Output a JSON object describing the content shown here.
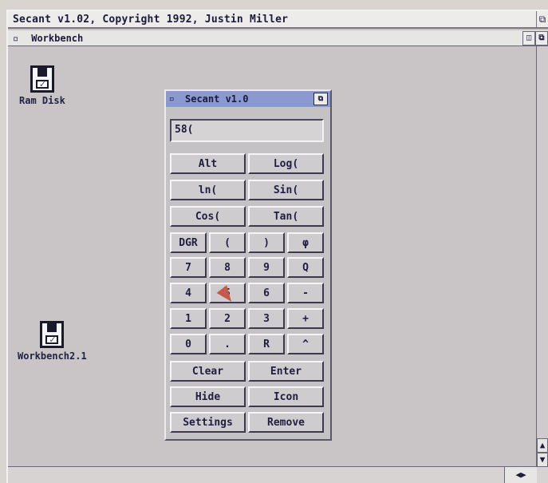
{
  "screen": {
    "title": "Secant v1.02, Copyright 1992, Justin Miller"
  },
  "workbench": {
    "title": "Workbench"
  },
  "desktop_icons": [
    {
      "label": "Ram Disk",
      "icon": "floppy-disk-icon"
    },
    {
      "label": "Workbench2.1",
      "icon": "floppy-disk-icon"
    }
  ],
  "calculator": {
    "title": "Secant v1.0",
    "display": "58(",
    "buttons": {
      "alt": "Alt",
      "log": "Log(",
      "ln": "ln(",
      "sin": "Sin(",
      "cos": "Cos(",
      "tan": "Tan(",
      "dgr": "DGR",
      "lparen": "(",
      "rparen": ")",
      "power": "φ",
      "7": "7",
      "8": "8",
      "9": "9",
      "div": "Q",
      "4": "4",
      "5": "5",
      "6": "6",
      "minus": "-",
      "1": "1",
      "2": "2",
      "3": "3",
      "plus": "+",
      "0": "0",
      "dot": ".",
      "r": "R",
      "caret": "^",
      "clear": "Clear",
      "enter": "Enter",
      "hide": "Hide",
      "icon": "Icon",
      "settings": "Settings",
      "remove": "Remove"
    }
  }
}
